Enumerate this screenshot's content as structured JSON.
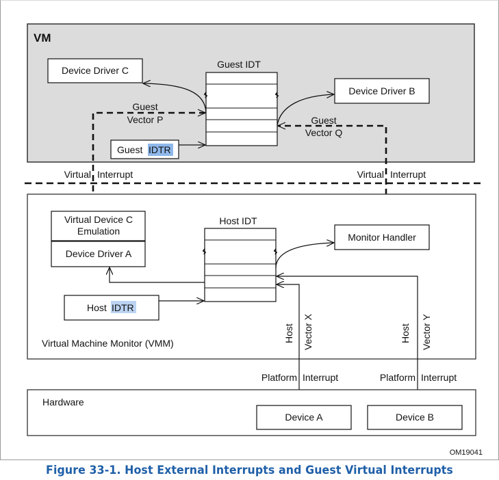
{
  "figure": {
    "caption": "Figure 33-1.  Host External Interrupts and Guest Virtual Interrupts",
    "figure_id": "OM19041"
  },
  "vm": {
    "title": "VM",
    "device_driver_c": "Device Driver C",
    "device_driver_b": "Device Driver B",
    "guest_idt_label": "Guest IDT",
    "guest_idtr_prefix": "Guest",
    "guest_idtr_highlight": "IDTR",
    "guest_vector_p_line1": "Guest",
    "guest_vector_p_line2": "Vector P",
    "guest_vector_q_line1": "Guest",
    "guest_vector_q_line2": "Vector Q"
  },
  "boundary": {
    "virtual_left": "Virtual",
    "interrupt_left": "Interrupt",
    "virtual_right": "Virtual",
    "interrupt_right": "Interrupt"
  },
  "vmm": {
    "title": "Virtual Machine Monitor (VMM)",
    "virtual_device_c_line1": "Virtual Device C",
    "virtual_device_c_line2": "Emulation",
    "device_driver_a": "Device Driver A",
    "host_idt_label": "Host IDT",
    "host_idtr_prefix": "Host",
    "host_idtr_highlight": "IDTR",
    "monitor_handler": "Monitor Handler",
    "host_vector_x_line1": "Host",
    "host_vector_x_line2": "Vector X",
    "host_vector_y_line1": "Host",
    "host_vector_y_line2": "Vector Y"
  },
  "platform": {
    "platform_a": "Platform",
    "interrupt_a": "Interrupt",
    "platform_b": "Platform",
    "interrupt_b": "Interrupt"
  },
  "hardware": {
    "title": "Hardware",
    "device_a": "Device A",
    "device_b": "Device B"
  }
}
